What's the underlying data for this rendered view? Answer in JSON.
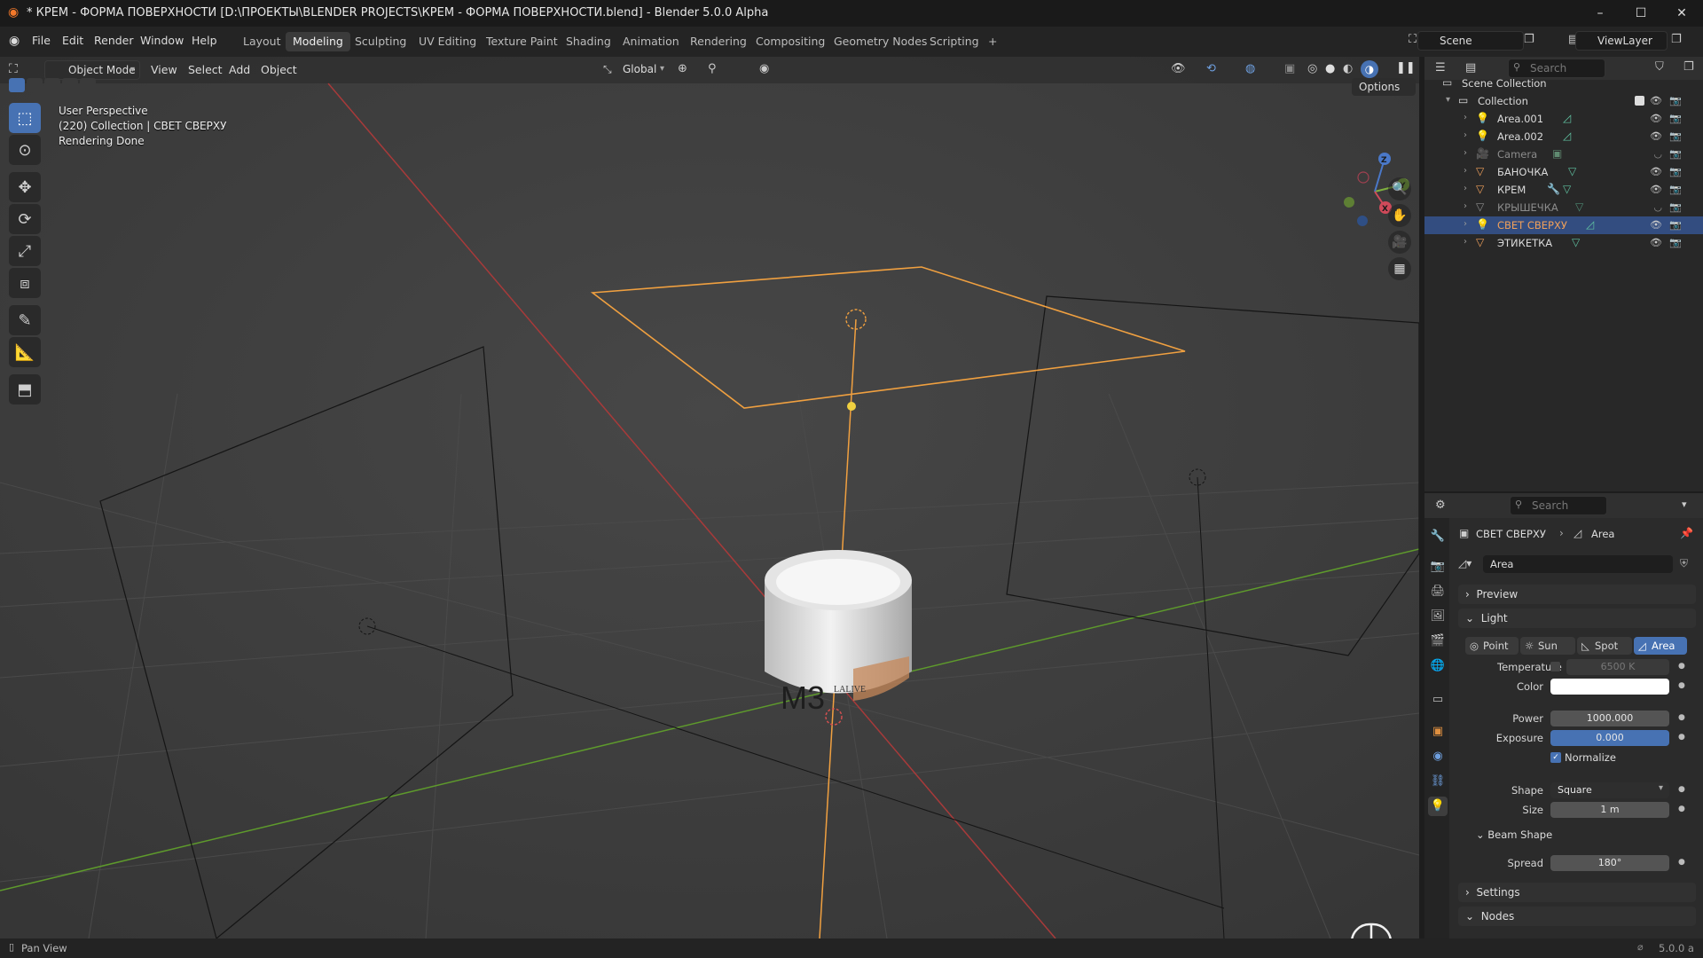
{
  "window": {
    "title": "* КРЕМ - ФОРМА ПОВЕРХНОСТИ [D:\\ПРОЕКТЫ\\BLENDER PROJECTS\\КРЕМ - ФОРМА ПОВЕРХНОСТИ.blend] - Blender 5.0.0 Alpha",
    "minimize": "–",
    "maximize": "☐",
    "close": "✕"
  },
  "menus": [
    "File",
    "Edit",
    "Render",
    "Window",
    "Help"
  ],
  "workspaces": [
    "Layout",
    "Modeling",
    "Sculpting",
    "UV Editing",
    "Texture Paint",
    "Shading",
    "Animation",
    "Rendering",
    "Compositing",
    "Geometry Nodes",
    "Scripting",
    "+"
  ],
  "active_workspace": "Modeling",
  "scene": "Scene",
  "view_layer": "ViewLayer",
  "viewport_header": {
    "mode": "Object Mode",
    "menus": [
      "View",
      "Select",
      "Add",
      "Object"
    ],
    "orientation": "Global",
    "options": "Options"
  },
  "viewport_info": {
    "line1": "User Perspective",
    "line2": "(220) Collection | СВЕТ СВЕРХУ",
    "line3": "Rendering Done"
  },
  "jar_label": "M3",
  "jar_brand": "LALIVE",
  "gizmo_axes": {
    "x": "X",
    "y": "Y",
    "z": "Z"
  },
  "outliner": {
    "search_placeholder": "Search",
    "scene_collection": "Scene Collection",
    "collection": "Collection",
    "items": [
      {
        "name": "Area.001",
        "icon": "light-icon",
        "hidden": false,
        "selected": false
      },
      {
        "name": "Area.002",
        "icon": "light-icon",
        "hidden": false,
        "selected": false
      },
      {
        "name": "Camera",
        "icon": "camera-icon",
        "hidden": true,
        "selected": false
      },
      {
        "name": "БАНОЧКА",
        "icon": "mesh-icon",
        "hidden": false,
        "selected": false
      },
      {
        "name": "КРЕМ",
        "icon": "mesh-icon",
        "hidden": false,
        "selected": false
      },
      {
        "name": "КРЫШЕЧКА",
        "icon": "mesh-icon",
        "hidden": true,
        "selected": false
      },
      {
        "name": "СВЕТ СВЕРХУ",
        "icon": "light-icon",
        "hidden": false,
        "selected": true
      },
      {
        "name": "ЭТИКЕТКА",
        "icon": "mesh-icon",
        "hidden": false,
        "selected": false
      }
    ]
  },
  "properties": {
    "search_placeholder": "Search",
    "breadcrumb_object": "СВЕТ СВЕРХУ",
    "breadcrumb_data": "Area",
    "datablock": "Area",
    "panels": {
      "preview": "Preview",
      "light": "Light",
      "beam_shape": "Beam Shape",
      "settings": "Settings",
      "nodes": "Nodes"
    },
    "light_types": [
      "Point",
      "Sun",
      "Spot",
      "Area"
    ],
    "active_light_type": "Area",
    "temperature_label": "Temperature",
    "temperature_value": "6500 K",
    "color_label": "Color",
    "color_value": "#ffffff",
    "power_label": "Power",
    "power_value": "1000.000",
    "exposure_label": "Exposure",
    "exposure_value": "0.000",
    "normalize_label": "Normalize",
    "normalize_checked": true,
    "shape_label": "Shape",
    "shape_value": "Square",
    "size_label": "Size",
    "size_value": "1 m",
    "spread_label": "Spread",
    "spread_value": "180°"
  },
  "statusbar": {
    "left": "Pan View",
    "version": "5.0.0 a"
  },
  "colors": {
    "accent": "#4772b3",
    "selection": "#334d80",
    "light_outline": "#f0a040",
    "x_axis": "#b33a3a",
    "y_axis": "#6aa030",
    "viewport_bg": "#3d3d3d"
  }
}
